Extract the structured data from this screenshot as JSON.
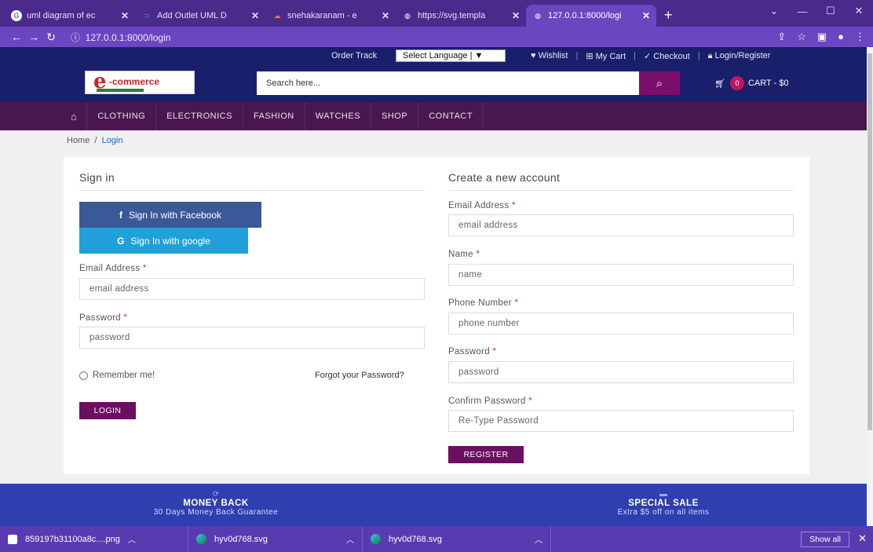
{
  "browser": {
    "tabs": [
      {
        "title": "uml diagram of ec",
        "fav": "G",
        "fav_color": "#4285f4"
      },
      {
        "title": "Add Outlet UML D",
        "fav": "⊃",
        "fav_color": "#29b6f6"
      },
      {
        "title": "snehakaranam - e",
        "fav": "☁",
        "fav_color": "#ff7043"
      },
      {
        "title": "https://svg.templa",
        "fav": "◍",
        "fav_color": "#ffffff"
      },
      {
        "title": "127.0.0.1:8000/logi",
        "fav": "◍",
        "fav_color": "#ffffff"
      }
    ],
    "url": "127.0.0.1:8000/login"
  },
  "topbar": {
    "order_track": "Order Track",
    "language": "Select Language | ▼",
    "wishlist": "Wishlist",
    "my_cart": "My Cart",
    "checkout": "Checkout",
    "login_register": "Login/Register"
  },
  "header": {
    "logo_text": "-commerce",
    "search_placeholder": "Search here...",
    "cart_count": "0",
    "cart_label": "CART - $0"
  },
  "nav": {
    "items": [
      "CLOTHING",
      "ELECTRONICS",
      "FASHION",
      "WATCHES",
      "SHOP",
      "CONTACT"
    ]
  },
  "breadcrumb": {
    "home": "Home",
    "sep": "/",
    "current": "Login"
  },
  "signin": {
    "title": "Sign in",
    "facebook": "Sign In with Facebook",
    "google": "Sign In with google",
    "email_label": "Email Address",
    "email_placeholder": "email address",
    "password_label": "Password",
    "password_placeholder": "password",
    "remember": "Remember me!",
    "forgot": "Forgot your Password?",
    "login": "LOGIN",
    "required": "*"
  },
  "register": {
    "title": "Create a new account",
    "email_label": "Email Address",
    "email_placeholder": "email address",
    "name_label": "Name",
    "name_placeholder": "name",
    "phone_label": "Phone Number",
    "phone_placeholder": "phone number",
    "password_label": "Password",
    "password_placeholder": "password",
    "confirm_label": "Confirm Password",
    "confirm_placeholder": "Re-Type Password",
    "register": "REGISTER",
    "required": "*"
  },
  "features": [
    {
      "title": "MONEY BACK",
      "subtitle": "30 Days Money Back Guarantee"
    },
    {
      "title": "SPECIAL SALE",
      "subtitle": "Extra $5 off on all items"
    }
  ],
  "downloads": {
    "items": [
      "859197b31100a8c....png",
      "hyv0d768.svg",
      "hyv0d768.svg"
    ],
    "show_all": "Show all"
  },
  "colors": {
    "brand_dark": "#1a1f6b",
    "nav_purple": "#4a1650",
    "button": "#6a0f62",
    "facebook": "#3b5998",
    "google": "#20a0d8"
  }
}
